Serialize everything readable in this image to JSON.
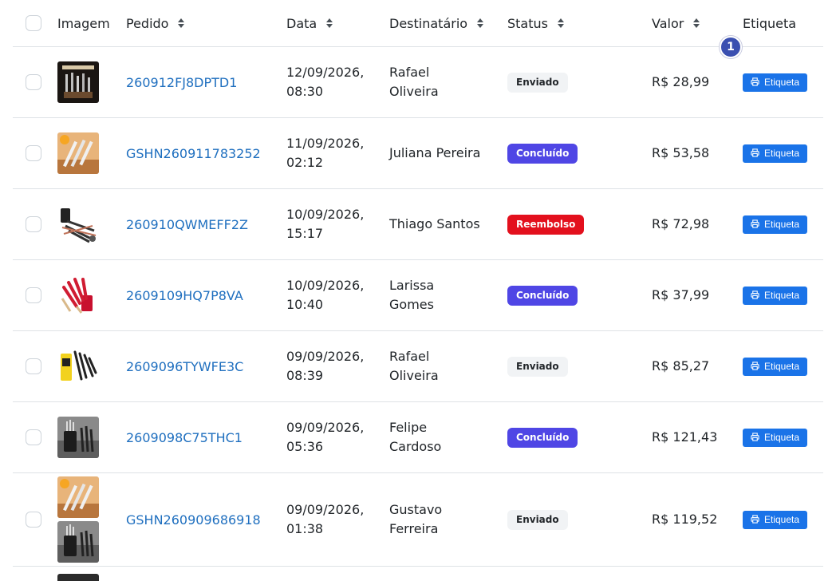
{
  "table": {
    "headers": {
      "image": "Imagem",
      "order": "Pedido",
      "date": "Data",
      "recipient": "Destinatário",
      "status": "Status",
      "value": "Valor",
      "label": "Etiqueta"
    },
    "rows": [
      {
        "order": "260912FJ8DPTD1",
        "date1": "12/09/2026,",
        "date2": "08:30",
        "name1": "Rafael",
        "name2": "Oliveira",
        "status": "Enviado",
        "value": "R$ 28,99",
        "label_btn": "Etiqueta"
      },
      {
        "order": "GSHN260911783252",
        "date1": "11/09/2026,",
        "date2": "02:12",
        "name1": "Juliana Pereira",
        "name2": "",
        "status": "Concluído",
        "value": "R$ 53,58",
        "label_btn": "Etiqueta"
      },
      {
        "order": "260910QWMEFF2Z",
        "date1": "10/09/2026,",
        "date2": "15:17",
        "name1": "Thiago Santos",
        "name2": "",
        "status": "Reembolso",
        "value": "R$ 72,98",
        "label_btn": "Etiqueta"
      },
      {
        "order": "2609109HQ7P8VA",
        "date1": "10/09/2026,",
        "date2": "10:40",
        "name1": "Larissa",
        "name2": "Gomes",
        "status": "Concluído",
        "value": "R$ 37,99",
        "label_btn": "Etiqueta"
      },
      {
        "order": "2609096TYWFE3C",
        "date1": "09/09/2026,",
        "date2": "08:39",
        "name1": "Rafael",
        "name2": "Oliveira",
        "status": "Enviado",
        "value": "R$ 85,27",
        "label_btn": "Etiqueta"
      },
      {
        "order": "2609098C75THC1",
        "date1": "09/09/2026,",
        "date2": "05:36",
        "name1": "Felipe",
        "name2": "Cardoso",
        "status": "Concluído",
        "value": "R$ 121,43",
        "label_btn": "Etiqueta"
      },
      {
        "order": "GSHN260909686918",
        "date1": "09/09/2026,",
        "date2": "01:38",
        "name1": "Gustavo",
        "name2": "Ferreira",
        "status": "Enviado",
        "value": "R$ 119,52",
        "label_btn": "Etiqueta"
      }
    ]
  },
  "step_marker": "1",
  "colors": {
    "link": "#1f6fbf",
    "label_button": "#1a73e8",
    "status_concluido": "#4f46e5",
    "status_reembolso": "#e3101d",
    "status_enviado": "#f1f3f5"
  }
}
